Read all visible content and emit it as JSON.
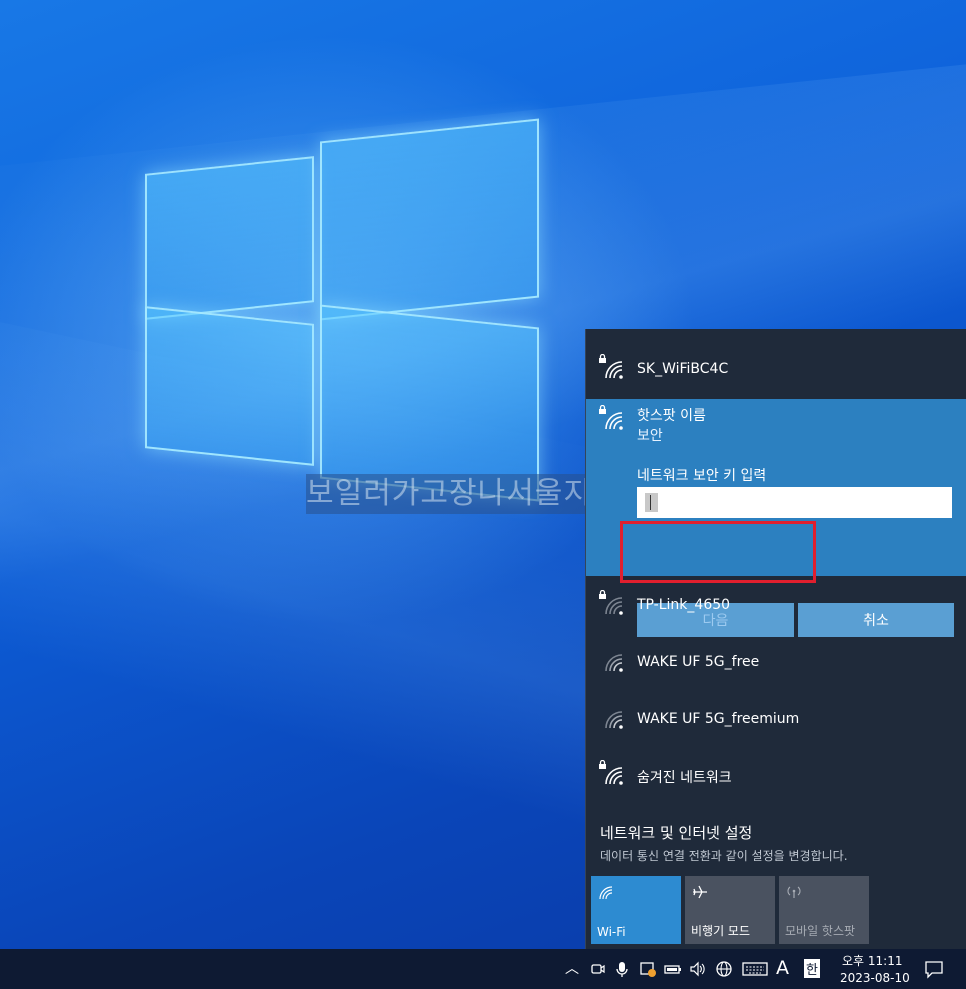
{
  "desktop": {
    "watermark": "보일러가고장나서울지"
  },
  "flyout": {
    "networks": [
      {
        "name": "SK_WiFiBC4C",
        "secured": true
      },
      {
        "name": "TP-Link_4650",
        "secured": true
      },
      {
        "name": "WAKE UF 5G_free",
        "secured": false
      },
      {
        "name": "WAKE UF 5G_freemium",
        "secured": false
      },
      {
        "name": "숨겨진 네트워크",
        "secured": true
      }
    ],
    "expanded": {
      "name": "핫스팟 이름",
      "security": "보안",
      "key_label": "네트워크 보안 키 입력",
      "key_value": "",
      "next_label": "다음",
      "cancel_label": "취소"
    },
    "settings_title": "네트워크 및 인터넷 설정",
    "settings_desc": "데이터 통신 연결 전환과 같이 설정을 변경합니다.",
    "tiles": {
      "wifi": "Wi-Fi",
      "airplane": "비행기 모드",
      "hotspot": "모바일 핫스팟"
    }
  },
  "taskbar": {
    "input_mode": "A",
    "ime": "한",
    "time": "오후 11:11",
    "date": "2023-08-10"
  },
  "colors": {
    "flyout_bg": "#1f2a3a",
    "accent": "#2c80c0",
    "highlight": "#e01f2e",
    "taskbar": "#0e1a33"
  }
}
